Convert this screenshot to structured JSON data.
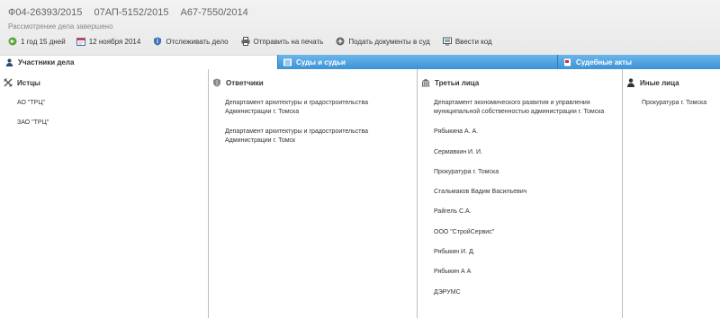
{
  "case": {
    "numbers": [
      "Ф04-26393/2015",
      "07АП-5152/2015",
      "А67-7550/2014"
    ],
    "status": "Рассмотрение дела завершено"
  },
  "toolbar": {
    "duration": "1 год 15 дней",
    "date": "12 ноября 2014",
    "track": "Отслеживать дело",
    "print": "Отправить на печать",
    "submit": "Подать документы в суд",
    "enter_code": "Ввести код"
  },
  "tabs": {
    "participants": "Участники дела",
    "courts": "Суды и судьи",
    "acts": "Судебные акты"
  },
  "columns": {
    "plaintiffs": {
      "title": "Истцы",
      "items": [
        "АО \"ТРЦ\"",
        "ЗАО \"ТРЦ\""
      ]
    },
    "defendants": {
      "title": "Ответчики",
      "items": [
        "Департамент архитектуры и градостроительства Администрации г. Томска",
        "Департамент архитектуры и градостроительства Администрации г. Томск"
      ]
    },
    "third": {
      "title": "Третьи лица",
      "items": [
        "Департамент экономического развития и управления муниципальной собственностью администрации г. Томска",
        "Рябыкина А. А.",
        "Сермавкин И. И.",
        "Прокуратура г. Томска",
        "Стальмаков Вадим Васильевич",
        "Райгель С.А.",
        "ООО \"СтройСервис\"",
        "Рябыкин И. Д.",
        "Рябыкин А А",
        "ДЭРУМС"
      ]
    },
    "other": {
      "title": "Иные лица",
      "items": [
        "Прокуратура г. Томска"
      ]
    }
  },
  "colors": {
    "tab_blue": "#3c93d6",
    "separator": "#bdbdbd",
    "header_bg": "#efefef"
  }
}
